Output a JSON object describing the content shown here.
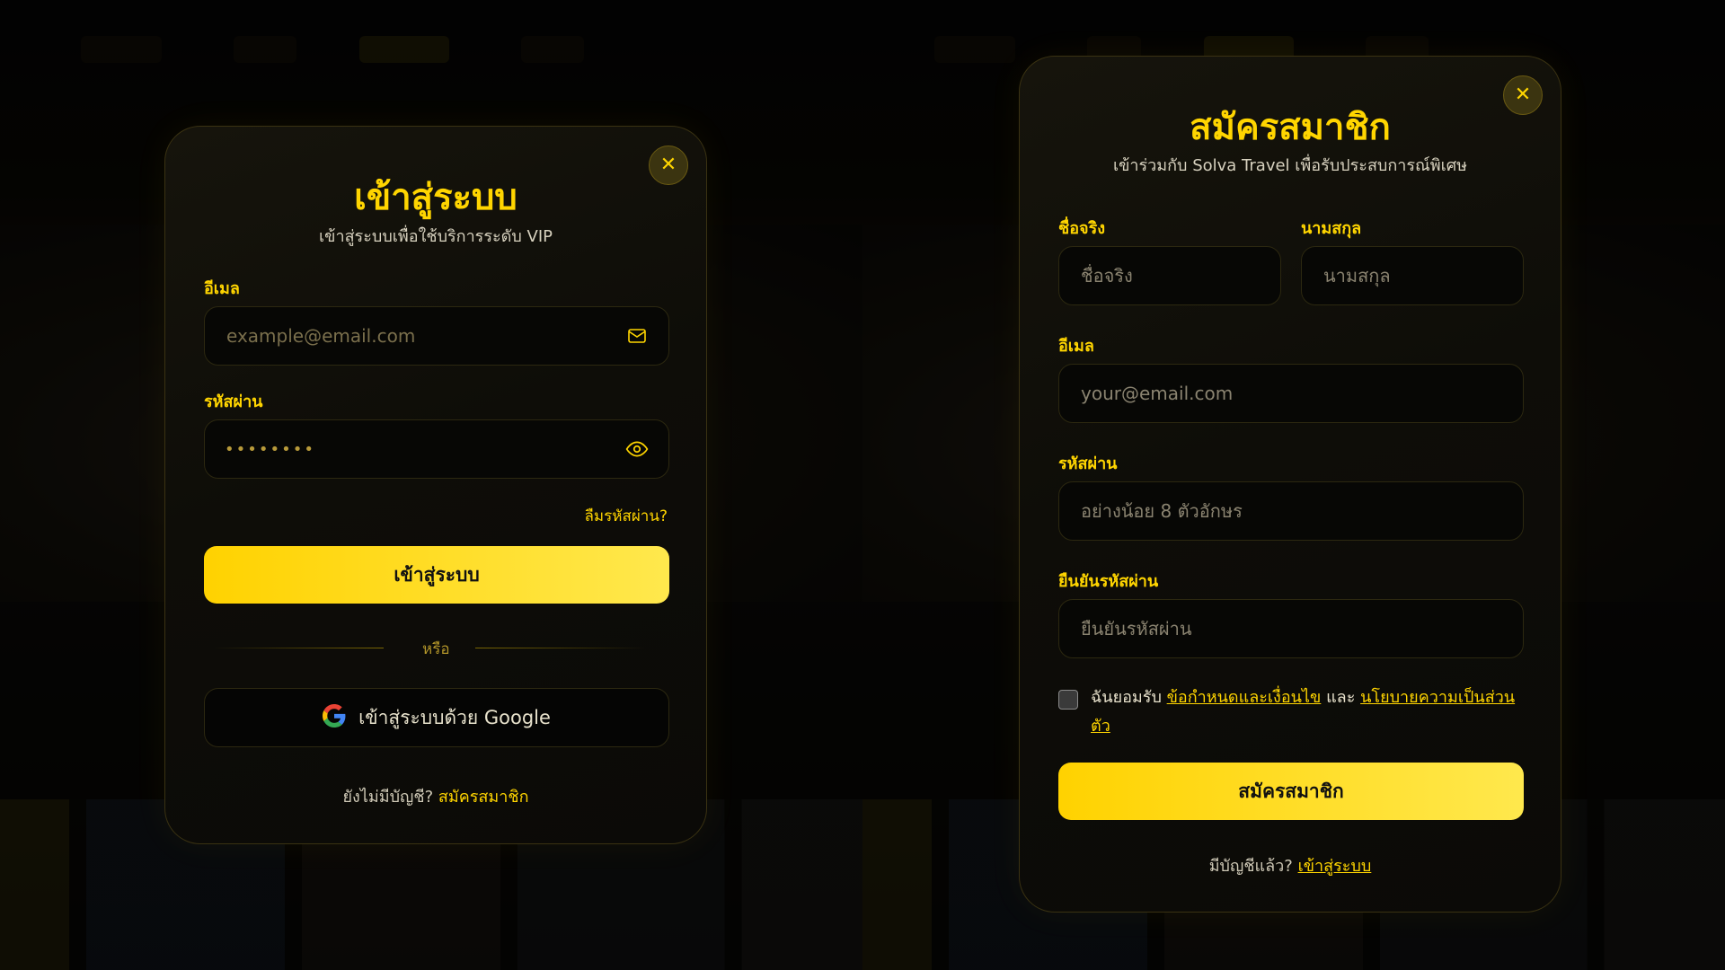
{
  "login": {
    "title": "เข้าสู่ระบบ",
    "subtitle": "เข้าสู่ระบบเพื่อใช้บริการระดับ VIP",
    "email_label": "อีเมล",
    "email_placeholder": "example@email.com",
    "password_label": "รหัสผ่าน",
    "password_value": "••••••••",
    "forgot_password": "ลืมรหัสผ่าน?",
    "submit_label": "เข้าสู่ระบบ",
    "divider_text": "หรือ",
    "google_label": "เข้าสู่ระบบด้วย Google",
    "footer_prompt": "ยังไม่มีบัญชี?",
    "footer_link": "สมัครสมาชิก",
    "close_icon": "✕"
  },
  "signup": {
    "title": "สมัครสมาชิก",
    "subtitle": "เข้าร่วมกับ Solva Travel เพื่อรับประสบการณ์พิเศษ",
    "first_name_label": "ชื่อจริง",
    "first_name_placeholder": "ชื่อจริง",
    "last_name_label": "นามสกุล",
    "last_name_placeholder": "นามสกุล",
    "email_label": "อีเมล",
    "email_placeholder": "your@email.com",
    "password_label": "รหัสผ่าน",
    "password_placeholder": "อย่างน้อย 8 ตัวอักษร",
    "confirm_label": "ยืนยันรหัสผ่าน",
    "confirm_placeholder": "ยืนยันรหัสผ่าน",
    "terms_prefix": "ฉันยอมรับ",
    "terms_link": "ข้อกำหนดและเงื่อนไข",
    "terms_and": "และ",
    "privacy_link": "นโยบายความเป็นส่วนตัว",
    "submit_label": "สมัครสมาชิก",
    "footer_prompt": "มีบัญชีแล้ว?",
    "footer_link": "เข้าสู่ระบบ",
    "close_icon": "✕"
  },
  "colors": {
    "accent": "#ffd500",
    "background": "#000000"
  }
}
